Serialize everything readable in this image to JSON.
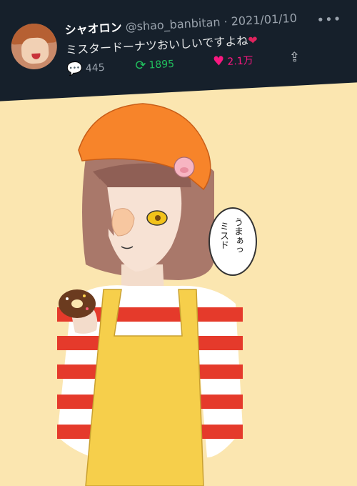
{
  "tweet": {
    "display_name": "シャオロン",
    "handle": "@shao_banbitan",
    "date": "2021/01/10",
    "separator": "·",
    "text": "ミスタードーナツおいしいですよね",
    "emoji": "❤",
    "more_icon": "more-horizontal-icon",
    "actions": {
      "reply_count": "445",
      "retweet_count": "1895",
      "like_count": "2.1万"
    },
    "colors": {
      "card_bg": "#16202b",
      "retweet": "#21c05e",
      "like": "#f91880",
      "muted": "#9aa3ad"
    }
  },
  "illustration": {
    "speech_bubble": {
      "line1": "うまぁっ",
      "line2": "ミスド"
    },
    "background": "#fbe6b0"
  }
}
